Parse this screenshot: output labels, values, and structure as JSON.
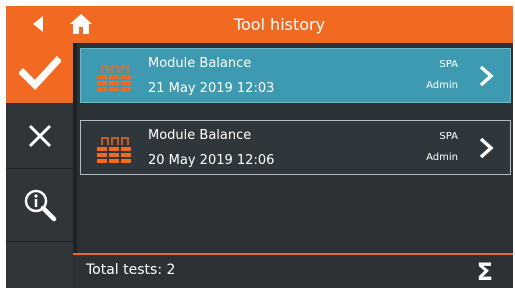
{
  "header": {
    "title": "Tool history",
    "back_icon": "back-arrow-icon",
    "home_icon": "home-icon",
    "accent_color": "#f26a21"
  },
  "sidebar": {
    "items": [
      {
        "icon": "checkmark-icon",
        "active": true
      },
      {
        "icon": "close-icon",
        "active": false
      },
      {
        "icon": "zoom-info-icon",
        "active": false
      }
    ]
  },
  "records": [
    {
      "name": "Module Balance",
      "date": "21 May 2019 12:03",
      "meta1": "SPA",
      "meta2": "Admin",
      "selected": true
    },
    {
      "name": "Module Balance",
      "date": "20 May 2019 12:06",
      "meta1": "SPA",
      "meta2": "Admin",
      "selected": false
    }
  ],
  "footer": {
    "total_text": "Total tests: 2",
    "sum_symbol": "Σ"
  }
}
